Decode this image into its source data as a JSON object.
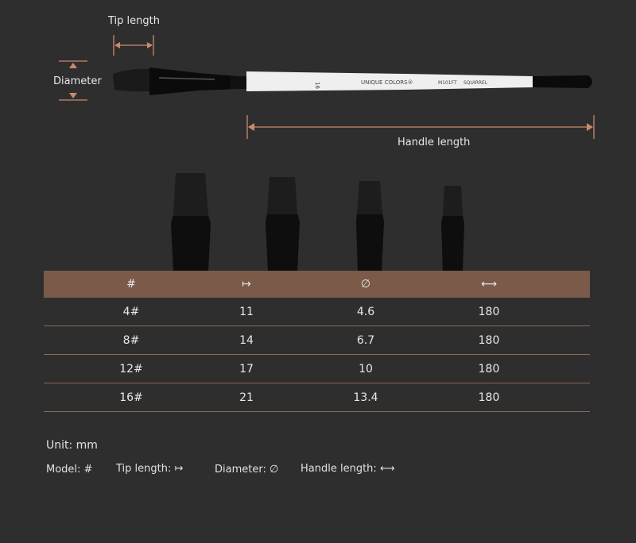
{
  "diagram": {
    "tip_length_label": "Tip length",
    "diameter_label": "Diameter",
    "handle_length_label": "Handle length",
    "brush_print": {
      "size": "16",
      "brand": "UNIQUE COLORS®",
      "model": "M101FT",
      "hair": "SQUIRREL"
    }
  },
  "table": {
    "headers": [
      "#",
      "↦",
      "∅",
      "⟷"
    ],
    "rows": [
      [
        "4#",
        "11",
        "4.6",
        "180"
      ],
      [
        "8#",
        "14",
        "6.7",
        "180"
      ],
      [
        "12#",
        "17",
        "10",
        "180"
      ],
      [
        "16#",
        "21",
        "13.4",
        "180"
      ]
    ]
  },
  "legend": {
    "unit": "Unit: mm",
    "model": "Model: #",
    "tip": "Tip length:",
    "diameter": "Diameter:",
    "handle": "Handle length:"
  },
  "colors": {
    "accent": "#c98a6c",
    "header": "#7b5a49",
    "background": "#2e2e2e"
  }
}
